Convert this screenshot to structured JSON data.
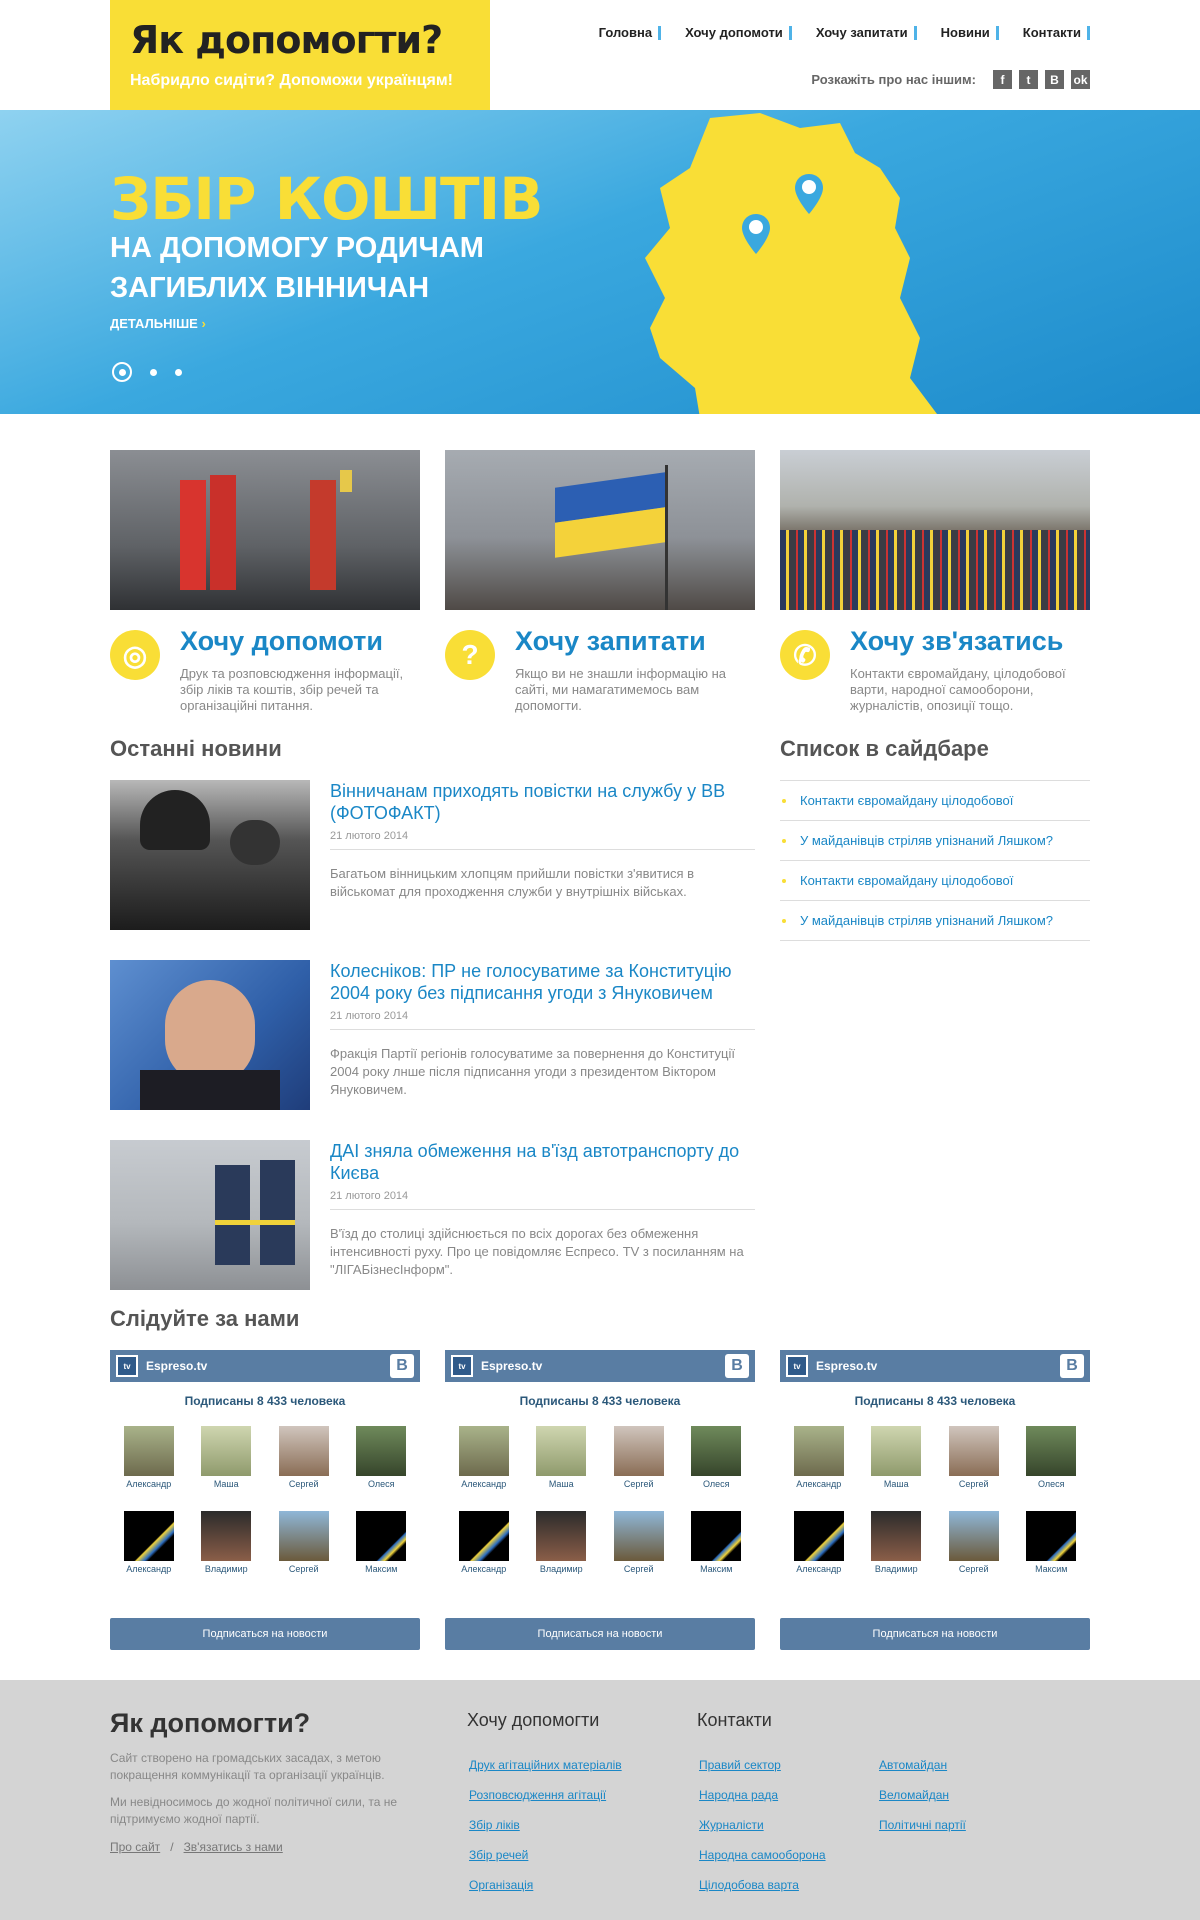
{
  "header": {
    "logo_title": "Як допомогти?",
    "logo_subtitle": "Набридло сидіти? Допоможи українцям!",
    "nav": [
      "Головна",
      "Хочу допомоти",
      "Хочу запитати",
      "Новини",
      "Контакти"
    ],
    "share_label": "Розкажіть про нас іншим:",
    "social": [
      "f",
      "t",
      "B",
      "ok"
    ]
  },
  "hero": {
    "title": "ЗБІР КОШТІВ",
    "subtitle": "НА ДОПОМОГУ РОДИЧАМ ЗАГИБЛИХ ВІННИЧАН",
    "more": "ДЕТАЛЬНІШЕ",
    "more_arrow": "›",
    "slides": 3,
    "active_slide": 1
  },
  "features": [
    {
      "icon": "lifebuoy-icon",
      "icon_glyph": "◎",
      "title": "Хочу допомоти",
      "text": "Друк та розповсюдження інформації, збір ліків та коштів, збір речей та організаційні питання."
    },
    {
      "icon": "question-icon",
      "icon_glyph": "?",
      "title": "Хочу запитати",
      "text": "Якщо ви не знашли інформацію на сайті, ми намагатимемось вам допомогти."
    },
    {
      "icon": "phone-icon",
      "icon_glyph": "✆",
      "title": "Хочу зв'язатись",
      "text": "Контакти євромайдану, цілодобової варти, народної самооборони, журналістів, опозиції тощо."
    }
  ],
  "news_section": {
    "title": "Останні новини",
    "items": [
      {
        "title": "Вінничанам приходять повістки на службу у ВВ (ФОТОФАКТ)",
        "date": "21 лютого 2014",
        "text": "Багатьом вінницьким хлопцям прийшли повістки з'явитися в військомат для проходження служби у внутрішніх військах."
      },
      {
        "title": "Колесніков: ПР не голосуватиме за Конституцію 2004 року без підписання угоди з Януковичем",
        "date": "21 лютого 2014",
        "text": "Фракція Партії регіонів голосуватиме за повернення до Конституції 2004 року лнше після підписання угоди з президентом Віктором Януковичем."
      },
      {
        "title": "ДАІ зняла обмеження на в'їзд автотранспорту до Києва",
        "date": "21 лютого 2014",
        "text": "В'їзд до столиці здійснюється по всіх дорогах без обмеження інтенсивності руху. Про це повідомляє Еспресо. TV з посиланням на \"ЛІГАБізнесІнформ\"."
      }
    ]
  },
  "sidebar": {
    "title": "Список в сайдбаре",
    "items": [
      "Контакти євромайдану цілодобової",
      "У майданівців стріляв упізнаний Ляшком?",
      "Контакти євромайдану цілодобової",
      "У майданівців стріляв упізнаний Ляшком?"
    ]
  },
  "follow": {
    "title": "Слідуйте за нами",
    "widget": {
      "name": "Espreso.tv",
      "logo_text": "tv",
      "vk_letter": "B",
      "count": "Подписаны 8 433 человека",
      "users": [
        "Александр",
        "Маша",
        "Сергей",
        "Олеся",
        "Александр",
        "Владимир",
        "Сергей",
        "Максим"
      ],
      "button": "Подписаться на новости"
    }
  },
  "footer": {
    "title": "Як допомогти?",
    "text1": "Сайт створено на громадських засадах, з метою покращення коммунікації та організації українців.",
    "text2": "Ми невідносимось до жодної політичної сили, та не підтримуємо жодної партії.",
    "link_about": "Про сайт",
    "link_sep": "/",
    "link_contact": "Зв'язатись з нами",
    "help_title": "Хочу допомогти",
    "help_links": [
      "Друк агітаційних матеріалів",
      "Розповсюдження агітації",
      "Збір ліків",
      "Збір речей",
      "Організація"
    ],
    "contacts_title": "Контакти",
    "contacts_links1": [
      "Правий сектор",
      "Народна рада",
      "Журналісти",
      "Народна самооборона",
      "Цілодобова варта"
    ],
    "contacts_links2": [
      "Автомайдан",
      "Веломайдан",
      "Політичні партії"
    ]
  },
  "colors": {
    "accent": "#f9de36",
    "link": "#1a87c6",
    "hero": "#3aa8df",
    "vk": "#597da3"
  }
}
